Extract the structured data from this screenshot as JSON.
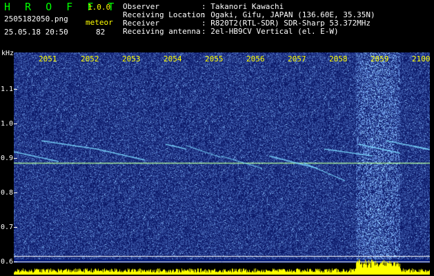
{
  "header": {
    "app_title": "H R O F F T",
    "version": "1.0.0",
    "filename": "2505182050.png",
    "meteor_label": "meteor",
    "datetime": "25.05.18 20:50",
    "meteor_count": "82"
  },
  "info": [
    {
      "label": "Observer",
      "value": ": Takanori Kawachi"
    },
    {
      "label": "Receiving Location",
      "value": ": Ogaki, Gifu, JAPAN (136.60E, 35.35N)"
    },
    {
      "label": "Receiver",
      "value": ": R820T2(RTL-SDR) SDR-Sharp 53.372MHz"
    },
    {
      "label": "Receiving antenna",
      "value": ": 2el-HB9CV Vertical (el. E-W)"
    }
  ],
  "spectrogram": {
    "unit_label": "kHz",
    "y_ticks": [
      "1.1",
      "1.0",
      "0.9",
      "0.8",
      "0.7",
      "0.6"
    ],
    "x_ticks": [
      "2051",
      "2052",
      "2053",
      "2054",
      "2055",
      "2056",
      "2057",
      "2058",
      "2059",
      "2100"
    ],
    "carrier_khz": 0.885,
    "colors": {
      "background": "#001a7a",
      "carrier": "#b4ff9a",
      "meteor": "#7ad8ff",
      "activity": "#ffff00"
    }
  }
}
